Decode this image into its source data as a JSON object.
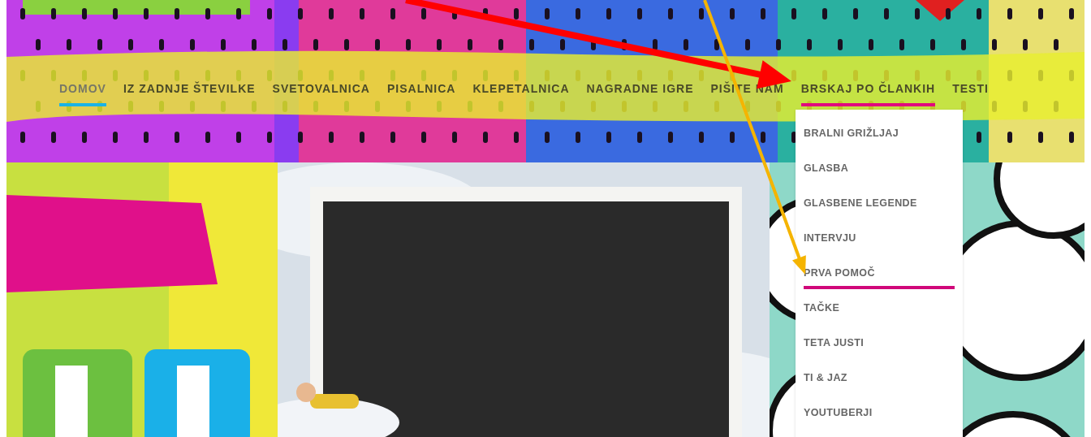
{
  "nav": {
    "items": [
      {
        "label": "DOMOV",
        "selected": true,
        "expanded": false
      },
      {
        "label": "IZ ZADNJE ŠTEVILKE",
        "selected": false,
        "expanded": false
      },
      {
        "label": "SVETOVALNICA",
        "selected": false,
        "expanded": false
      },
      {
        "label": "PISALNICA",
        "selected": false,
        "expanded": false
      },
      {
        "label": "KLEPETALNICA",
        "selected": false,
        "expanded": false
      },
      {
        "label": "NAGRADNE IGRE",
        "selected": false,
        "expanded": false
      },
      {
        "label": "PIŠITE NAM",
        "selected": false,
        "expanded": false
      },
      {
        "label": "BRSKAJ PO ČLANKIH",
        "selected": false,
        "expanded": true
      },
      {
        "label": "TESTI",
        "selected": false,
        "expanded": false
      }
    ]
  },
  "dropdown": {
    "items": [
      {
        "label": "BRALNI GRIŽLJAJ",
        "hovered": false
      },
      {
        "label": "GLASBA",
        "hovered": false
      },
      {
        "label": "GLASBENE LEGENDE",
        "hovered": false
      },
      {
        "label": "INTERVJU",
        "hovered": false
      },
      {
        "label": "PRVA POMOČ",
        "hovered": true
      },
      {
        "label": "TAČKE",
        "hovered": false
      },
      {
        "label": "TETA JUSTI",
        "hovered": false
      },
      {
        "label": "TI & JAZ",
        "hovered": false
      },
      {
        "label": "YOUTUBERJI",
        "hovered": false
      }
    ]
  },
  "annotation_arrows": [
    {
      "color": "#ff0000"
    },
    {
      "color": "#f5b400"
    }
  ]
}
